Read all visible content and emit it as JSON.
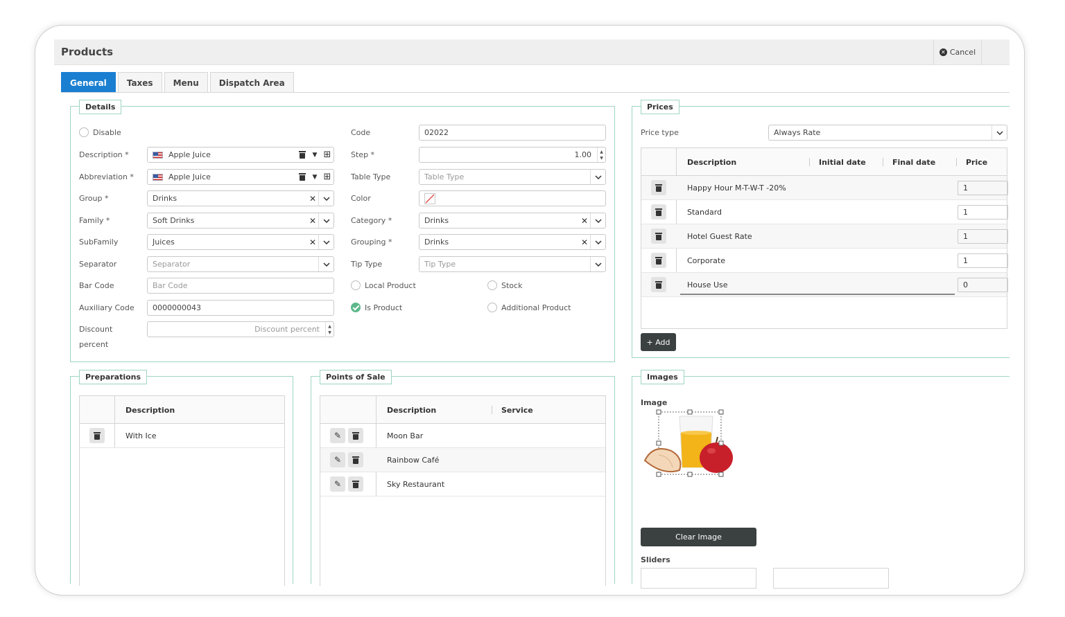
{
  "header": {
    "title": "Products",
    "cancel_label": "Cancel"
  },
  "tabs": [
    "General",
    "Taxes",
    "Menu",
    "Dispatch Area"
  ],
  "details": {
    "legend": "Details",
    "disable_label": "Disable",
    "description_label": "Description *",
    "description_value": "Apple Juice",
    "abbreviation_label": "Abbreviation *",
    "abbreviation_value": "Apple Juice",
    "group_label": "Group *",
    "group_value": "Drinks",
    "family_label": "Family *",
    "family_value": "Soft Drinks",
    "subfamily_label": "SubFamily",
    "subfamily_value": "Juices",
    "separator_label": "Separator",
    "separator_placeholder": "Separator",
    "barcode_label": "Bar Code",
    "barcode_placeholder": "Bar Code",
    "auxcode_label": "Auxiliary Code",
    "auxcode_value": "0000000043",
    "discount_label_1": "Discount",
    "discount_label_2": "percent",
    "discount_placeholder": "Discount percent",
    "code_label": "Code",
    "code_value": "02022",
    "step_label": "Step *",
    "step_value": "1.00",
    "tabletype_label": "Table Type",
    "tabletype_placeholder": "Table Type",
    "color_label": "Color",
    "category_label": "Category *",
    "category_value": "Drinks",
    "grouping_label": "Grouping *",
    "grouping_value": "Drinks",
    "tiptype_label": "Tip Type",
    "tiptype_placeholder": "Tip Type",
    "local_product_label": "Local Product",
    "stock_label": "Stock",
    "is_product_label": "Is Product",
    "is_product_checked": true,
    "additional_product_label": "Additional Product"
  },
  "prices": {
    "legend": "Prices",
    "price_type_label": "Price type",
    "price_type_value": "Always Rate",
    "columns": [
      "Description",
      "Initial date",
      "Final date",
      "Price"
    ],
    "rows": [
      {
        "description": "Happy Hour M-T-W-T -20%",
        "price": "1"
      },
      {
        "description": "Standard",
        "price": "1"
      },
      {
        "description": "Hotel Guest Rate",
        "price": "1"
      },
      {
        "description": "Corporate",
        "price": "1"
      },
      {
        "description": "House Use",
        "price": "0"
      }
    ],
    "add_label": "+ Add"
  },
  "preparations": {
    "legend": "Preparations",
    "column": "Description",
    "rows": [
      "With Ice"
    ]
  },
  "points_of_sale": {
    "legend": "Points of Sale",
    "columns": [
      "Description",
      "Service"
    ],
    "rows": [
      "Moon Bar",
      "Rainbow Café",
      "Sky Restaurant"
    ]
  },
  "images": {
    "legend": "Images",
    "image_label": "Image",
    "clear_label": "Clear Image",
    "sliders_label": "Sliders"
  }
}
